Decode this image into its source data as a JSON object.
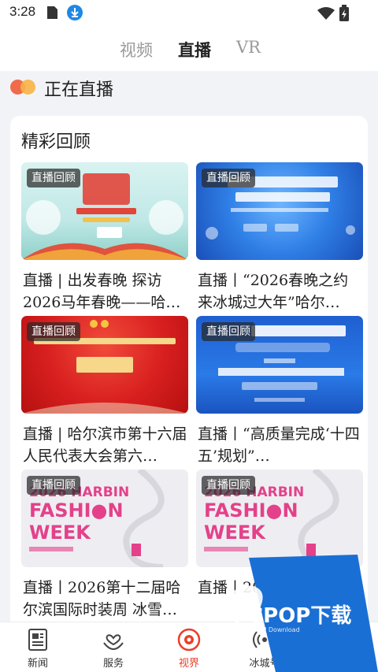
{
  "status_bar": {
    "time": "3:28"
  },
  "top_tabs": [
    {
      "label": "视频"
    },
    {
      "label": "直播"
    },
    {
      "label": "VR"
    }
  ],
  "live_section": {
    "title": "正在直播"
  },
  "replay_section": {
    "title": "精彩回顾",
    "items": [
      {
        "badge": "直播回顾",
        "title": "直播 | 出发春晚 探访2026马年春晚——哈…",
        "thumb_text": "出发春晚"
      },
      {
        "badge": "直播回顾",
        "title": "直播丨“2026春晚之约 来冰城过大年”哈尔…",
        "thumb_text": "2026春晚之约"
      },
      {
        "badge": "直播回顾",
        "title": "直播 | 哈尔滨市第十六届人民代表大会第六…",
        "thumb_text": "开幕会"
      },
      {
        "badge": "直播回顾",
        "title": "直播丨“高质量完成‘十四五’规划”…",
        "thumb_text": "坚持以人民为中心"
      },
      {
        "badge": "直播回顾",
        "title": "直播丨2026第十二届哈尔滨国际时装周 冰雪…",
        "thumb_text": "FASHION WEEK"
      },
      {
        "badge": "直播回顾",
        "title": "直播丨2026…",
        "thumb_text": "FASHION WEEK"
      }
    ]
  },
  "bottom_nav": [
    {
      "label": "新闻",
      "icon": "newspaper-icon"
    },
    {
      "label": "服务",
      "icon": "heart-hands-icon"
    },
    {
      "label": "视界",
      "icon": "eye-camera-icon"
    },
    {
      "label": "冰城号",
      "icon": "broadcast-icon"
    }
  ],
  "watermark": {
    "text": "PCPOP下载",
    "sub": "PCPOP Download"
  },
  "colors": {
    "accent": "#e8402c",
    "badge_bg": "#333333",
    "watermark_blue": "#1a6fd4"
  }
}
